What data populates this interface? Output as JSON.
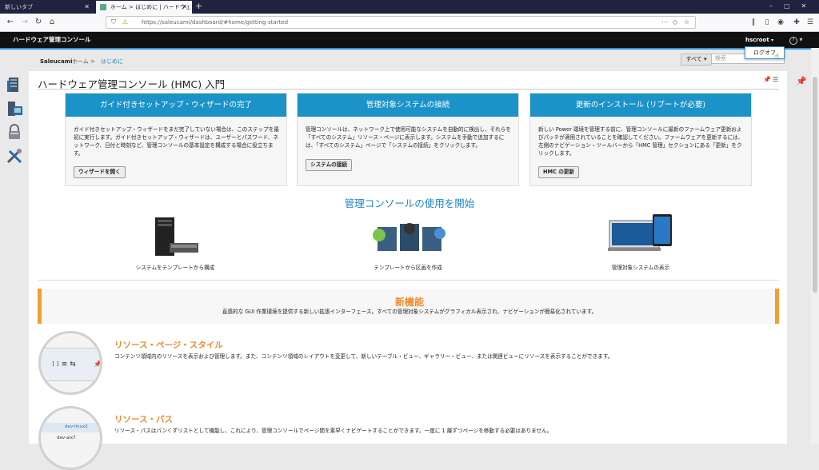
{
  "browser": {
    "tabs": [
      {
        "label": "新しいタブ"
      },
      {
        "label": "ホーム > はじめに | ハードウェア管理コンソール"
      }
    ],
    "new_tab": "+",
    "url": "https://saleucami/dashboard/#home/getting-started"
  },
  "app": {
    "title": "ハードウェア管理コンソール",
    "user": "hscroot",
    "logout": "ログオフ",
    "help": "?"
  },
  "breadcrumb": {
    "system": "Saleucami",
    "home": "ホーム",
    "current": "はじめに"
  },
  "filter": {
    "label": "すべて",
    "search_placeholder": "検索"
  },
  "page": {
    "title": "ハードウェア管理コンソール (HMC) 入門"
  },
  "cards": [
    {
      "title": "ガイド付きセットアップ・ウィザードの完了",
      "body": "ガイド付きセットアップ・ウィザードをまだ完了していない場合は、このステップを最初に実行します。ガイド付きセットアップ・ウィザードは、ユーザーとパスワード、ネットワーク、日付と時刻など、管理コンソールの基本設定を構成する場合に役立ちます。",
      "button": "ウィザードを開く"
    },
    {
      "title": "管理対象システムの接続",
      "body": "管理コンソールは、ネットワーク上で使用可能なシステムを自動的に検出し、それらを「すべてのシステム」リソース・ページに表示します。システムを手動で追加するには、「すべてのシステム」ページで「システムの接続」をクリックします。",
      "button": "システムの接続"
    },
    {
      "title": "更新のインストール (リブートが必要)",
      "body": "新しい Power 環境を管理する前に、管理コンソールに最新のファームウェア更新およびパッチが適用されていることを確認してください。ファームウェアを更新するには、左側のナビゲーション・ツールバーから「HMC 管理」セクションにある「更新」をクリックします。",
      "button": "HMC の更新"
    }
  ],
  "usage": {
    "title": "管理コンソールの使用を開始",
    "items": [
      {
        "caption": "システムをテンプレートから構成"
      },
      {
        "caption": "テンプレートから区画を作成"
      },
      {
        "caption": "管理対象システムの表示"
      }
    ]
  },
  "whats_new": {
    "title": "新機能",
    "desc": "直感的な GUI 作業環境を提供する新しい拡張インターフェース。すべての管理対象システムがグラフィカル表示され、ナビゲーションが簡易化されています。"
  },
  "features": [
    {
      "title": "リソース・ページ・スタイル",
      "desc": "コンテンツ領域内のリソースを表示および管理します。また、コンテンツ領域のレイアウトを変更して、新しいテーブル・ビュー、ギャラリー・ビュー、または関連ビューにリソースを表示することができます。"
    },
    {
      "title": "リソース・パス",
      "desc": "リソース・パスはパンくずリストとして機能し、これにより、管理コンソールでページ間を素早くナビゲートすることができます。一度に 1 層ずつページを移動する必要はありません。"
    }
  ],
  "circle_labels": {
    "c2a": "dev-linux2",
    "c2b": "dev-aix7"
  },
  "colors": {
    "accent": "#1b93c9",
    "orange": "#f08c30",
    "header": "#111111"
  }
}
